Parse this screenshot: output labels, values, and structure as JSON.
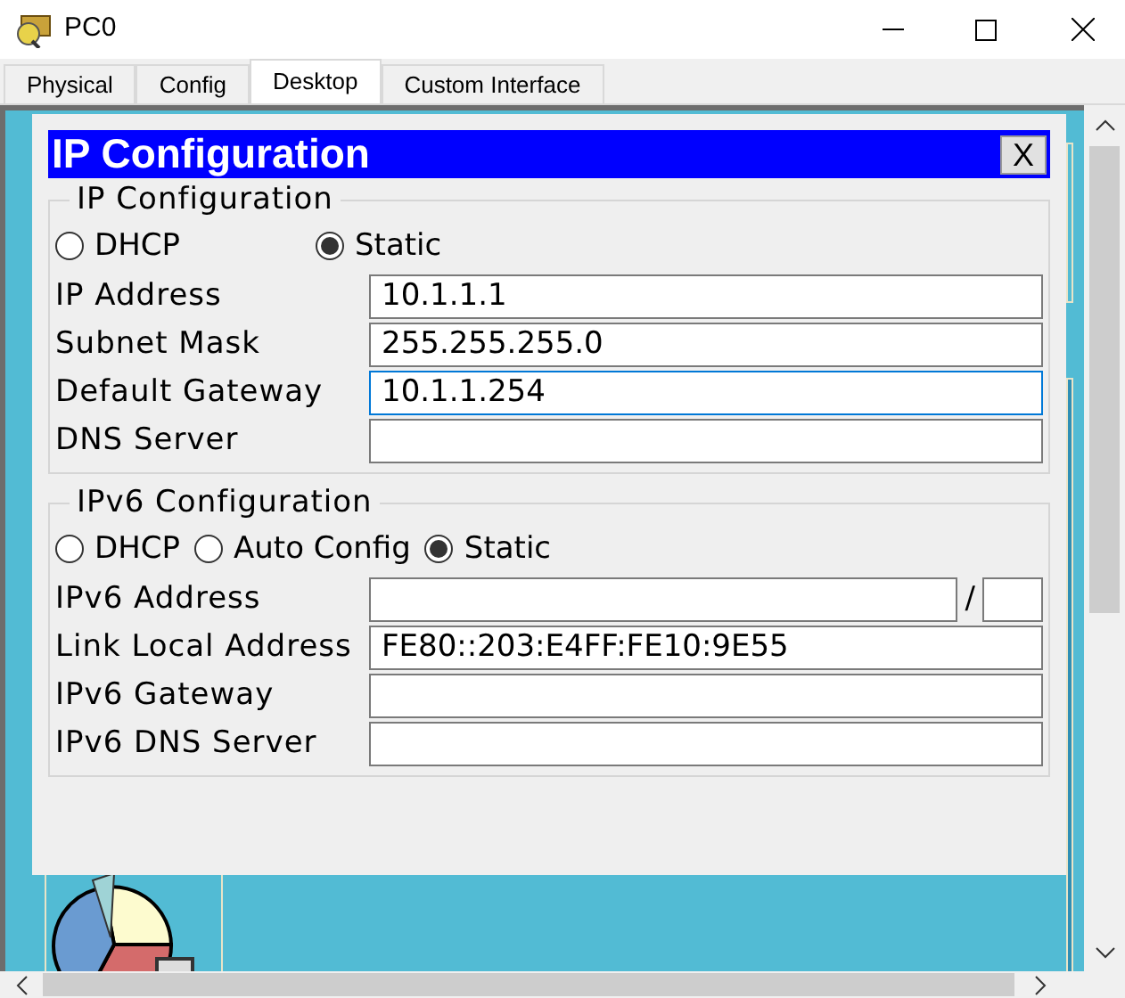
{
  "window": {
    "title": "PC0"
  },
  "tabs": [
    {
      "label": "Physical",
      "selected": false
    },
    {
      "label": "Config",
      "selected": false
    },
    {
      "label": "Desktop",
      "selected": true
    },
    {
      "label": "Custom Interface",
      "selected": false
    }
  ],
  "dialog": {
    "title": "IP Configuration",
    "close": "X",
    "ipv4": {
      "legend": "IP Configuration",
      "modes": [
        {
          "label": "DHCP",
          "selected": false
        },
        {
          "label": "Static",
          "selected": true
        }
      ],
      "fields": [
        {
          "label": "IP Address",
          "value": "10.1.1.1",
          "focused": false
        },
        {
          "label": "Subnet Mask",
          "value": "255.255.255.0",
          "focused": false
        },
        {
          "label": "Default Gateway",
          "value": "10.1.1.254",
          "focused": true
        },
        {
          "label": "DNS Server",
          "focused": false
        }
      ]
    },
    "ipv6": {
      "legend": "IPv6 Configuration",
      "modes": [
        {
          "label": "DHCP",
          "selected": false
        },
        {
          "label": "Auto Config",
          "selected": false
        },
        {
          "label": "Static",
          "selected": true
        }
      ],
      "fields": [
        {
          "label": "IPv6 Address",
          "kind": "prefix",
          "separator": "/",
          "focused": false
        },
        {
          "label": "Link Local Address",
          "value": "FE80::203:E4FF:FE10:9E55",
          "focused": false
        },
        {
          "label": "IPv6 Gateway",
          "focused": false
        },
        {
          "label": "IPv6 DNS Server",
          "focused": false
        }
      ]
    }
  }
}
